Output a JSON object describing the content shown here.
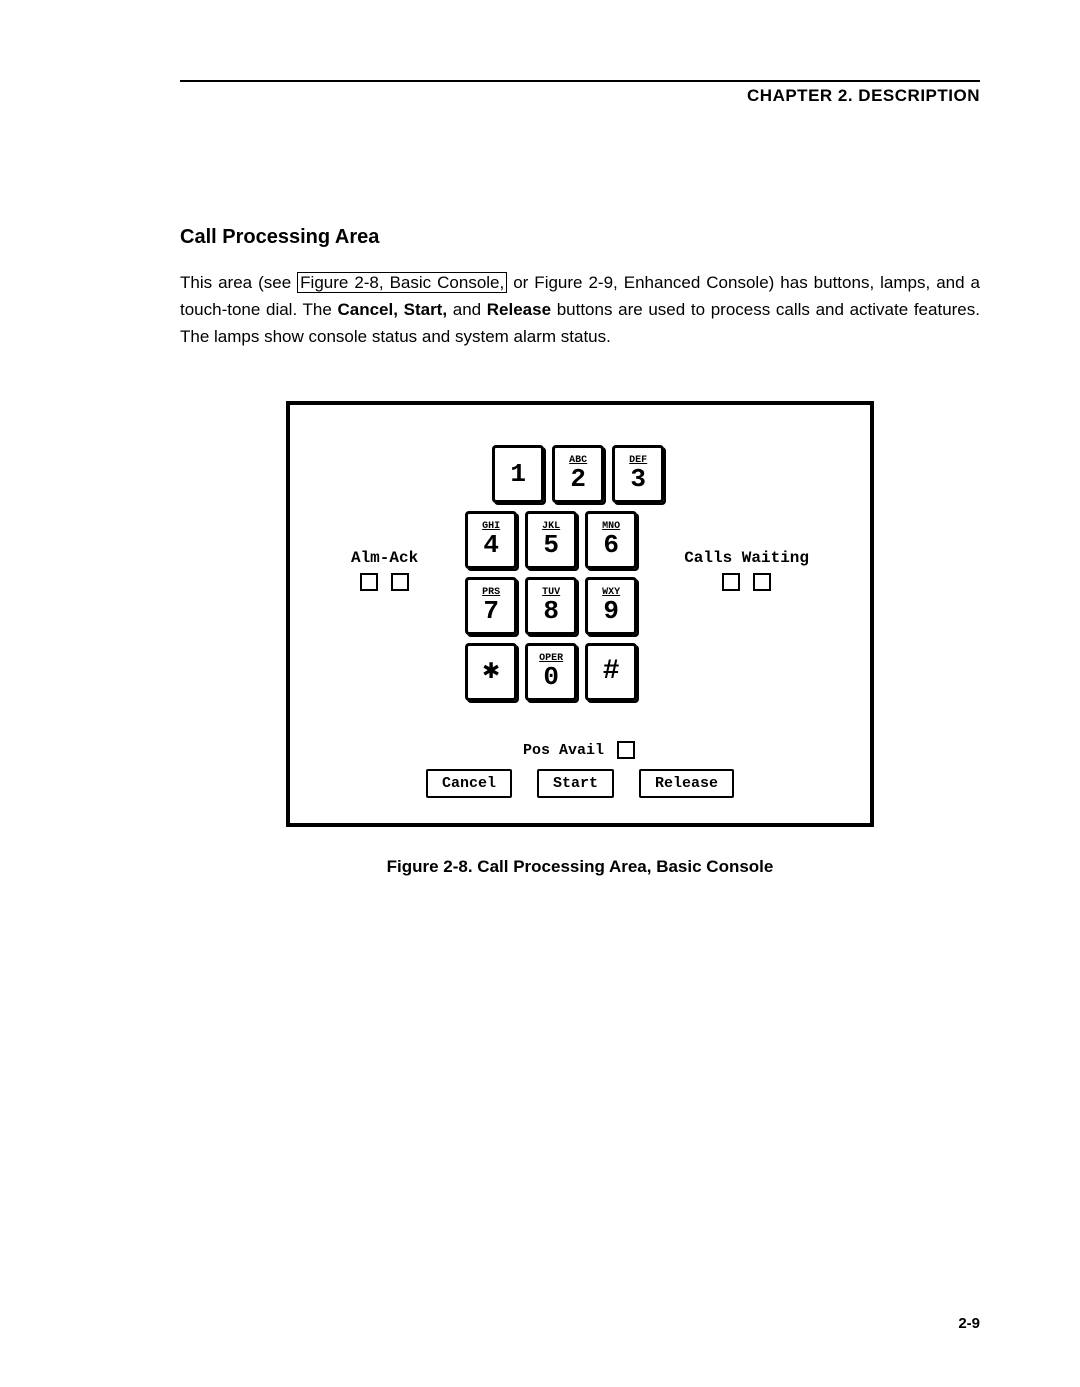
{
  "header": "CHAPTER 2. DESCRIPTION",
  "section_title": "Call Processing Area",
  "body": {
    "pre_link": "This area (see ",
    "link": "Figure 2-8, Basic Console,",
    "mid1": " or Figure 2-9, Enhanced Console) has buttons, lamps, and a touch-tone dial. The ",
    "b1": "Cancel, Start,",
    "mid2": " and ",
    "b2": "Release",
    "post": " buttons are used to process calls and activate features. The lamps show console status and system alarm status."
  },
  "figure": {
    "left_label": "Alm-Ack",
    "right_label": "Calls Waiting",
    "pos_avail": "Pos Avail",
    "keys": {
      "1": {
        "sup": "",
        "num": "1"
      },
      "2": {
        "sup": "ABC",
        "num": "2"
      },
      "3": {
        "sup": "DEF",
        "num": "3"
      },
      "4": {
        "sup": "GHI",
        "num": "4"
      },
      "5": {
        "sup": "JKL",
        "num": "5"
      },
      "6": {
        "sup": "MNO",
        "num": "6"
      },
      "7": {
        "sup": "PRS",
        "num": "7"
      },
      "8": {
        "sup": "TUV",
        "num": "8"
      },
      "9": {
        "sup": "WXY",
        "num": "9"
      },
      "star": {
        "sym": "✱"
      },
      "0": {
        "sup": "OPER",
        "num": "0"
      },
      "hash": {
        "sym": "#"
      }
    },
    "buttons": {
      "cancel": "Cancel",
      "start": "Start",
      "release": "Release"
    }
  },
  "caption": "Figure 2-8. Call Processing Area, Basic Console",
  "page_number": "2-9"
}
